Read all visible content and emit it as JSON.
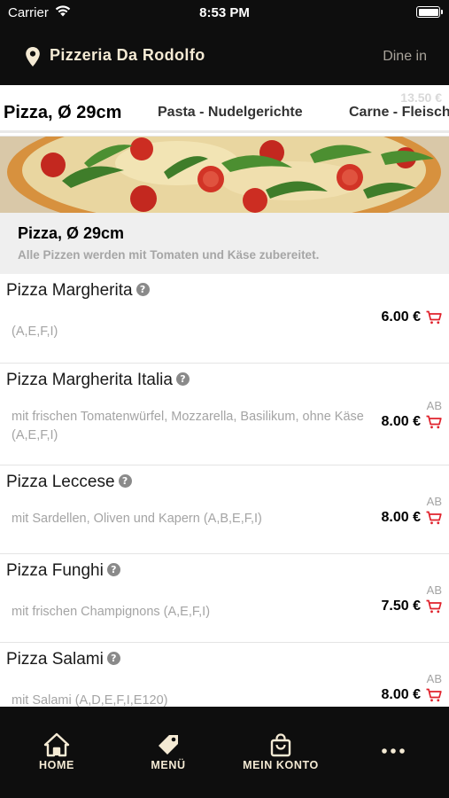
{
  "status_bar": {
    "carrier": "Carrier",
    "time": "8:53 PM"
  },
  "header": {
    "restaurant_name": "Pizzeria Da Rodolfo",
    "mode": "Dine in"
  },
  "tabs": {
    "items": [
      {
        "label": "Pizza, Ø 29cm",
        "active": true
      },
      {
        "label": "Pasta - Nudelgerichte",
        "active": false
      },
      {
        "label": "Carne - Fleisch",
        "active": false
      }
    ],
    "background_price": "13.50 €"
  },
  "category": {
    "title": "Pizza, Ø 29cm",
    "description": "Alle Pizzen werden mit Tomaten und Käse zubereitet."
  },
  "items": [
    {
      "name": "Pizza Margherita",
      "description": "(A,E,F,I)",
      "prefix": "",
      "price": "6.00 €"
    },
    {
      "name": "Pizza Margherita Italia",
      "description": "mit frischen Tomatenwürfel, Mozzarella, Basilikum, ohne Käse (A,E,F,I)",
      "prefix": "AB",
      "price": "8.00 €"
    },
    {
      "name": "Pizza Leccese",
      "description": "mit Sardellen, Oliven und Kapern (A,B,E,F,I)",
      "prefix": "AB",
      "price": "8.00 €"
    },
    {
      "name": "Pizza Funghi",
      "description": "mit frischen Champignons (A,E,F,I)",
      "prefix": "AB",
      "price": "7.50 €"
    },
    {
      "name": "Pizza Salami",
      "description": "mit Salami (A,D,E,F,I,E120)",
      "prefix": "AB",
      "price": "8.00 €"
    }
  ],
  "info_glyph": "?",
  "nav": {
    "home": "HOME",
    "menu": "MENÜ",
    "account": "MEIN KONTO",
    "more": "more-icon"
  },
  "colors": {
    "header_bg": "#0e0e0e",
    "accent_text": "#f4ead4",
    "cart_red": "#e0222c",
    "category_bg": "#efefef"
  }
}
